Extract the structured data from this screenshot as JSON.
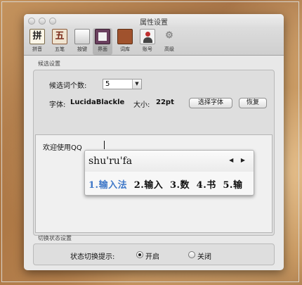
{
  "window": {
    "title": "属性设置"
  },
  "toolbar": {
    "items": [
      {
        "label": "拼音",
        "glyph": "拼",
        "icon": "pinyin-icon"
      },
      {
        "label": "五笔",
        "glyph": "五",
        "icon": "wubi-icon"
      },
      {
        "label": "按键",
        "glyph": "",
        "icon": "keys-icon"
      },
      {
        "label": "界面",
        "glyph": "",
        "icon": "interface-icon",
        "selected": true
      },
      {
        "label": "词库",
        "glyph": "",
        "icon": "dictionary-icon"
      },
      {
        "label": "账号",
        "glyph": "",
        "icon": "account-icon"
      },
      {
        "label": "高级",
        "glyph": "⚙",
        "icon": "gear-icon"
      }
    ]
  },
  "candidates_group": {
    "title": "候选设置",
    "count_label": "候选词个数:",
    "count_value": "5",
    "font_label": "字体:",
    "font_value": "LucidaBlackle",
    "size_label": "大小:",
    "size_value": "22pt",
    "choose_font_button": "选择字体",
    "restore_button": "恢复"
  },
  "preview": {
    "text": "欢迎使用QQ",
    "ime": {
      "pinyin": "shu'ru'fa",
      "nav_prev": "◀",
      "nav_next": "▶",
      "candidates": [
        "1.输入法",
        "2.输入",
        "3.数",
        "4.书",
        "5.输"
      ]
    }
  },
  "status_group": {
    "title": "切换状态设置",
    "label": "状态切换提示:",
    "option_on": "开启",
    "option_off": "关闭",
    "selected": "开启"
  }
}
